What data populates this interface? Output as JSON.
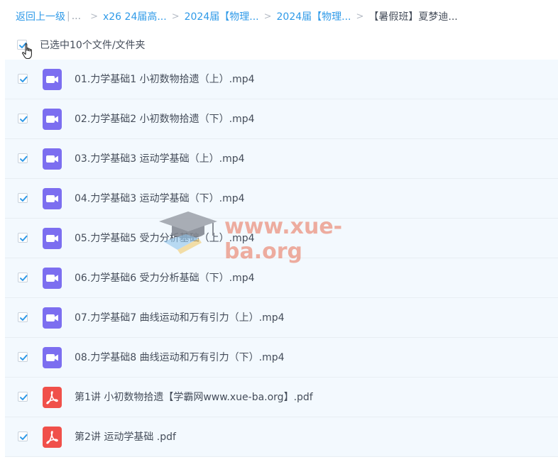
{
  "breadcrumb": {
    "back": "返回上一级",
    "bar": "|",
    "ellipsis": "...",
    "sep": ">",
    "items": [
      "x26 24届高...",
      "2024届【物理...",
      "2024届【物理..."
    ],
    "current": "【暑假班】夏梦迪..."
  },
  "selection": {
    "text": "已选中10个文件/文件夹"
  },
  "files": [
    {
      "name": "01.力学基础1 小初数物拾遗（上）.mp4",
      "type": "video"
    },
    {
      "name": "02.力学基础2 小初数物拾遗（下）.mp4",
      "type": "video"
    },
    {
      "name": "03.力学基础3 运动学基础（上）.mp4",
      "type": "video"
    },
    {
      "name": "04.力学基础3 运动学基础（下）.mp4",
      "type": "video"
    },
    {
      "name": "05.力学基础5 受力分析基础（上）.mp4",
      "type": "video"
    },
    {
      "name": "06.力学基础6 受力分析基础（下）.mp4",
      "type": "video"
    },
    {
      "name": "07.力学基础7 曲线运动和万有引力（上）.mp4",
      "type": "video"
    },
    {
      "name": "08.力学基础8 曲线运动和万有引力（下）.mp4",
      "type": "video"
    },
    {
      "name": "第1讲 小初数物拾遗【学霸网www.xue-ba.org】.pdf",
      "type": "pdf"
    },
    {
      "name": "第2讲 运动学基础 .pdf",
      "type": "pdf"
    }
  ],
  "watermark": {
    "text": "www.xue-ba.org"
  },
  "colors": {
    "accent": "#2f9ae8",
    "video_icon": "#7c6ef0",
    "pdf_icon": "#f0504a",
    "row_bg": "#f3f9fe"
  },
  "icons": {
    "video": "video-file-icon",
    "pdf": "pdf-file-icon",
    "check": "check-icon",
    "cursor": "hand-pointer-icon"
  }
}
